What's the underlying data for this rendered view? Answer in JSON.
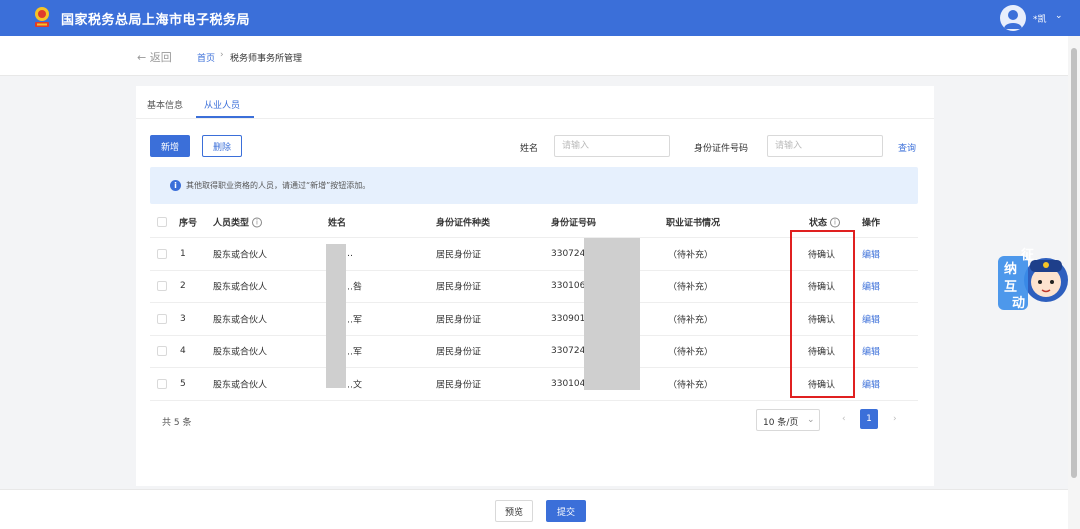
{
  "header": {
    "title": "国家税务总局上海市电子税务局",
    "username": "*凯",
    "user_caret": "⌄"
  },
  "breadcrumb": {
    "back": "← 返回",
    "home": "首页",
    "separator": "›",
    "current": "税务师事务所管理"
  },
  "tabs": [
    {
      "label": "基本信息",
      "active": false
    },
    {
      "label": "从业人员",
      "active": true
    }
  ],
  "toolbar": {
    "add_label": "新增",
    "delete_label": "删除",
    "name_label": "姓名",
    "name_placeholder": "请输入",
    "id_label": "身份证件号码",
    "id_placeholder": "请输入",
    "query_label": "查询"
  },
  "info": {
    "text": "其他取得职业资格的人员，请通过“新增”按钮添加。"
  },
  "table": {
    "headers": [
      "序号",
      "人员类型",
      "姓名",
      "身份证件种类",
      "身份证号码",
      "职业证书情况",
      "状态",
      "操作"
    ],
    "rows": [
      {
        "index": "1",
        "type": "股东或合伙人",
        "name": "…",
        "id_type": "居民身份证",
        "id_no": "330724",
        "cert": "（待补充）",
        "status": "待确认",
        "action": "编辑"
      },
      {
        "index": "2",
        "type": "股东或合伙人",
        "name": "…咎",
        "id_type": "居民身份证",
        "id_no": "330106",
        "cert": "（待补充）",
        "status": "待确认",
        "action": "编辑"
      },
      {
        "index": "3",
        "type": "股东或合伙人",
        "name": "…军",
        "id_type": "居民身份证",
        "id_no": "330901",
        "cert": "（待补充）",
        "status": "待确认",
        "action": "编辑"
      },
      {
        "index": "4",
        "type": "股东或合伙人",
        "name": "…军",
        "id_type": "居民身份证",
        "id_no": "330724",
        "cert": "（待补充）",
        "status": "待确认",
        "action": "编辑"
      },
      {
        "index": "5",
        "type": "股东或合伙人",
        "name": "…文",
        "id_type": "居民身份证",
        "id_no": "330104",
        "cert": "（待补充）",
        "status": "待确认",
        "action": "编辑"
      }
    ]
  },
  "pagination": {
    "total": "共 5 条",
    "page_size": "10 条/页",
    "page_size_caret": "⌄",
    "prev": "‹",
    "current_page": "1",
    "next": "›"
  },
  "footer": {
    "preview_label": "预览",
    "submit_label": "提交"
  },
  "widget": {
    "chars": [
      "征",
      "纳",
      "互",
      "动"
    ]
  },
  "colors": {
    "primary": "#3b6fd9",
    "highlight": "#e02020",
    "info_bg": "#e6f0fd"
  }
}
